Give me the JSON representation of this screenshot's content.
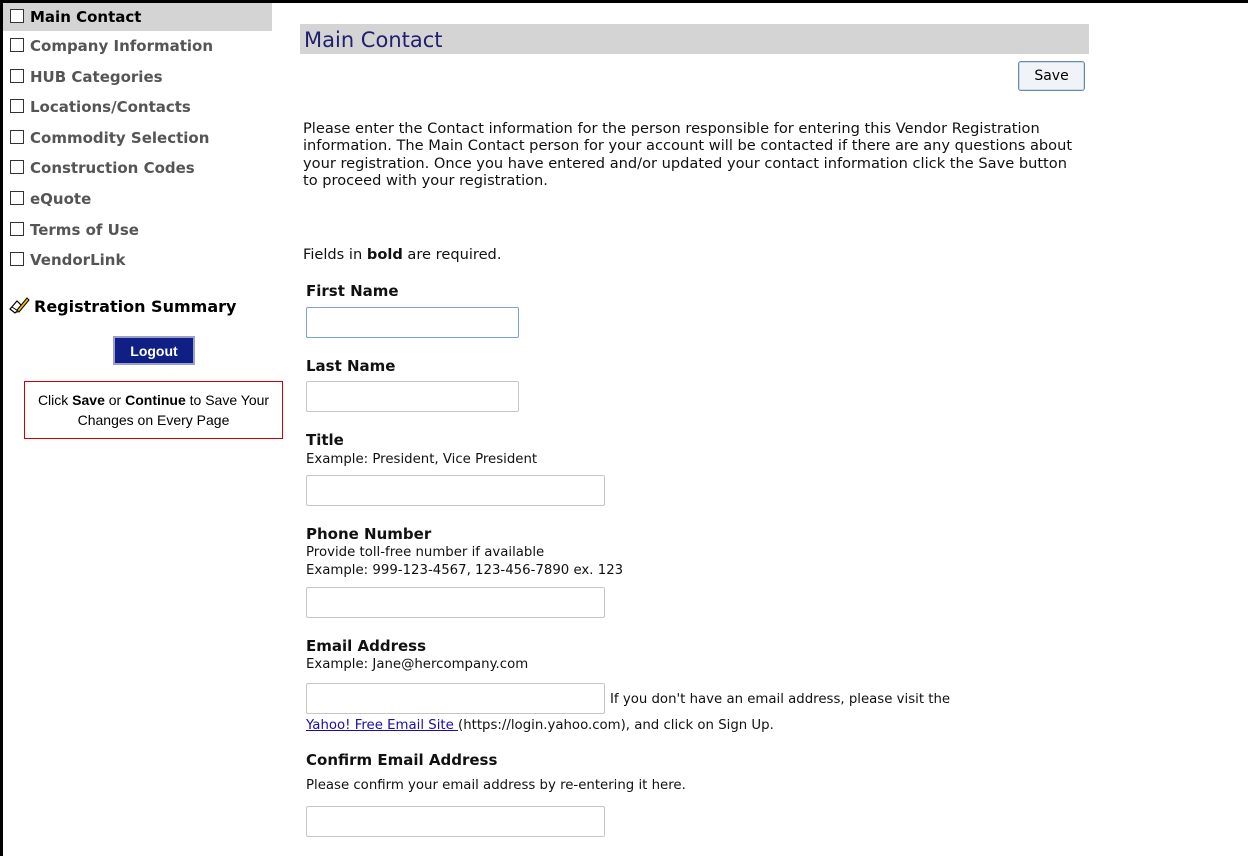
{
  "sidebar": {
    "items": [
      {
        "label": "Main Contact",
        "active": true
      },
      {
        "label": "Company Information"
      },
      {
        "label": "HUB Categories"
      },
      {
        "label": "Locations/Contacts"
      },
      {
        "label": "Commodity Selection"
      },
      {
        "label": "Construction Codes"
      },
      {
        "label": "eQuote"
      },
      {
        "label": "Terms of Use"
      },
      {
        "label": "VendorLink"
      }
    ],
    "registration_summary": "Registration Summary",
    "logout_label": "Logout",
    "note": {
      "prefix": "Click ",
      "save": "Save",
      "middle": " or ",
      "continue": "Continue",
      "suffix": " to Save Your Changes on Every Page"
    }
  },
  "main": {
    "title": "Main Contact",
    "save_label": "Save",
    "intro": "Please enter the Contact information for the person responsible for entering this Vendor Registration information. The Main Contact person for your account will be contacted if there are any questions about your registration. Once you have entered and/or updated your contact information click the Save button to proceed with your registration.",
    "required_note": {
      "prefix": "Fields in ",
      "bold": "bold",
      "suffix": " are required."
    },
    "fields": {
      "first_name": {
        "label": "First Name",
        "value": ""
      },
      "last_name": {
        "label": "Last Name",
        "value": ""
      },
      "title": {
        "label": "Title",
        "hint": "Example: President, Vice President",
        "value": ""
      },
      "phone": {
        "label": "Phone Number",
        "hint1": "Provide toll-free number if available",
        "hint2": "Example: 999-123-4567, 123-456-7890 ex. 123",
        "value": ""
      },
      "email": {
        "label": "Email Address",
        "hint": "Example: Jane@hercompany.com",
        "value": ""
      },
      "confirm_email": {
        "label": "Confirm Email Address",
        "hint": "Please confirm your email address by re-entering it here.",
        "value": ""
      }
    },
    "email_help": {
      "line1": "If you don't have an email address, please visit the",
      "link_text": "Yahoo! Free Email Site ",
      "line2_suffix": "(https://login.yahoo.com), and click on Sign Up."
    }
  }
}
